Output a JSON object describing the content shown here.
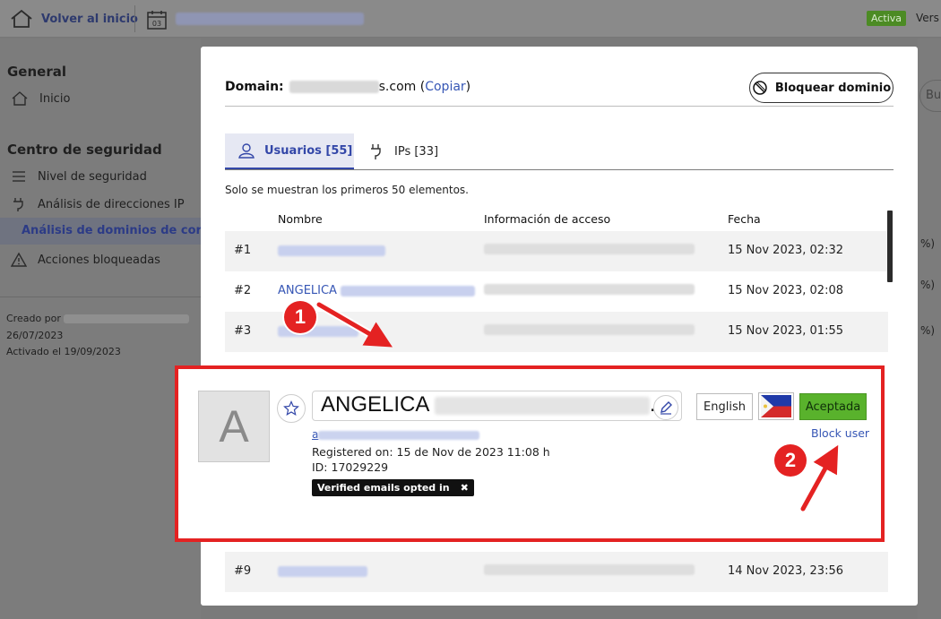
{
  "topbar": {
    "home_label": "Volver al inicio",
    "status_badge": "Activa",
    "version_label": "Vers"
  },
  "sidebar": {
    "general_heading": "General",
    "inicio": "Inicio",
    "security_heading": "Centro de seguridad",
    "items": [
      {
        "label": "Nivel de seguridad"
      },
      {
        "label": "Análisis de direcciones IP"
      },
      {
        "label": "Análisis de dominios de corre"
      },
      {
        "label": "Acciones bloqueadas"
      }
    ],
    "created_by": "Creado por",
    "created_date": "26/07/2023",
    "activated": "Activado el 19/09/2023"
  },
  "background_right": {
    "search_hint": "Bu",
    "pct": "%)"
  },
  "modal": {
    "domain_label": "Domain:",
    "domain_suffix": "s.com",
    "copy_open": "(",
    "copy_label": "Copiar",
    "copy_close": ")",
    "block_domain_label": "Bloquear dominio",
    "tabs": [
      {
        "label": "Usuarios [55]"
      },
      {
        "label": "IPs [33]"
      }
    ],
    "note": "Solo se muestran los primeros 50 elementos.",
    "columns": [
      "Nombre",
      "Información de acceso",
      "Fecha"
    ],
    "rows": [
      {
        "idx": "#1",
        "name_prefix": "",
        "date": "15 Nov 2023, 02:32"
      },
      {
        "idx": "#2",
        "name_prefix": "ANGELICA",
        "date": "15 Nov 2023, 02:08"
      },
      {
        "idx": "#3",
        "name_prefix": "",
        "date": "15 Nov 2023, 01:55"
      }
    ],
    "row9": {
      "idx": "#9",
      "date": "14 Nov 2023, 23:56"
    }
  },
  "user_card": {
    "avatar_letter": "A",
    "first_name": "ANGELICA",
    "name_ellipsis": "...",
    "email_initial": "a",
    "registered": "Registered on: 15 de Nov de 2023 11:08 h",
    "id": "ID: 17029229",
    "verified_chip": "Verified emails opted in",
    "language": "English",
    "status": "Aceptada",
    "block_user": "Block user"
  },
  "annotations": {
    "step1": "1",
    "step2": "2"
  },
  "colors": {
    "accent_blue": "#3347a8",
    "link_blue": "#3656b5",
    "highlight_red": "#e42222",
    "status_green": "#59b22c"
  }
}
